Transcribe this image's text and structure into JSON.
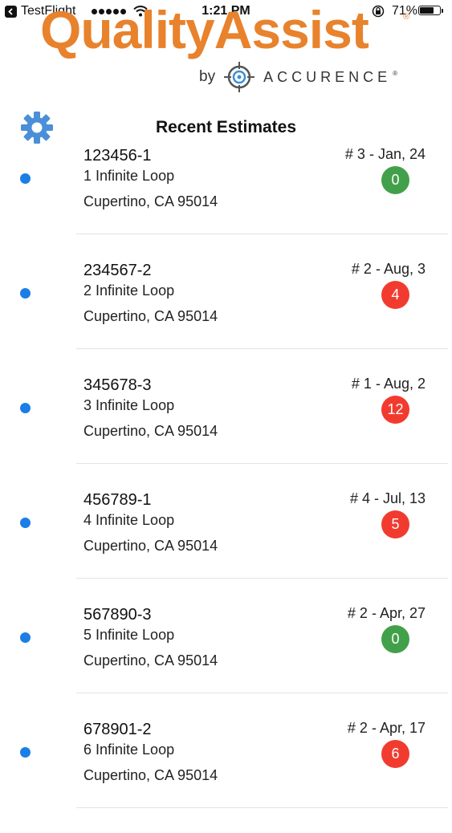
{
  "status_bar": {
    "back_app": "TestFlight",
    "time": "1:21 PM",
    "battery": "71%",
    "icons": [
      "back-chevron-icon",
      "signal-dots-icon",
      "wifi-icon",
      "rotation-lock-icon",
      "battery-icon"
    ]
  },
  "logo": {
    "wordmark": "QualityAssist",
    "registered": "®",
    "by": "by",
    "company": "ACCURENCE",
    "company_registered": "®",
    "brand_color": "#e8822c"
  },
  "header": {
    "settings_icon": "gear-icon",
    "title": "Recent Estimates"
  },
  "colors": {
    "dot": "#1a7ee6",
    "badge_green": "#43a04a",
    "badge_red": "#f23b2f"
  },
  "estimates": [
    {
      "id": "123456-1",
      "address_line1": "1 Infinite Loop",
      "address_line2": "Cupertino, CA 95014",
      "meta": "# 3 - Jan, 24",
      "count": "0",
      "status": "green"
    },
    {
      "id": "234567-2",
      "address_line1": "2 Infinite Loop",
      "address_line2": "Cupertino, CA 95014",
      "meta": "# 2 - Aug, 3",
      "count": "4",
      "status": "red"
    },
    {
      "id": "345678-3",
      "address_line1": "3 Infinite Loop",
      "address_line2": "Cupertino, CA 95014",
      "meta": "# 1 - Aug, 2",
      "count": "12",
      "status": "red"
    },
    {
      "id": "456789-1",
      "address_line1": "4 Infinite Loop",
      "address_line2": "Cupertino, CA 95014",
      "meta": "# 4 - Jul, 13",
      "count": "5",
      "status": "red"
    },
    {
      "id": "567890-3",
      "address_line1": "5 Infinite Loop",
      "address_line2": "Cupertino, CA 95014",
      "meta": "# 2 - Apr, 27",
      "count": "0",
      "status": "green"
    },
    {
      "id": "678901-2",
      "address_line1": "6 Infinite Loop",
      "address_line2": "Cupertino, CA 95014",
      "meta": "# 2 - Apr, 17",
      "count": "6",
      "status": "red"
    }
  ]
}
